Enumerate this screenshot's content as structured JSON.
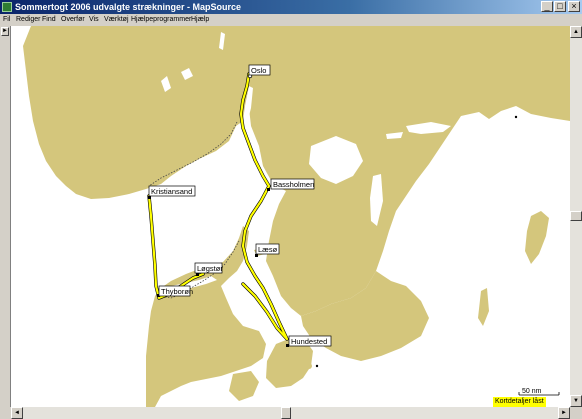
{
  "window": {
    "title": "Sommertogt 2006 udvalgte strækninger - MapSource",
    "min_glyph": "_",
    "max_glyph": "□",
    "close_glyph": "×"
  },
  "menu": {
    "items": [
      "Fil",
      "Rediger",
      "Find",
      "Overfør",
      "Vis",
      "Værktøj",
      "Hjælpeprogrammer",
      "Hjælp"
    ]
  },
  "map": {
    "land_color": "#d4c67c",
    "water_color": "#ffffff",
    "route_color": "#ffff00",
    "places": {
      "oslo": "Oslo",
      "bassholmen": "Bassholmen",
      "kristiansand": "Kristiansand",
      "laeso": "Læsø",
      "logstor": "Løgstør",
      "thyboron": "Thyborøn",
      "hundested": "Hundested"
    },
    "scale_label": "50 nm",
    "status": "Kortdetaljer låst"
  },
  "icons": {
    "app": "mapsource-icon",
    "left_arrow": "►",
    "up_arrow": "▲",
    "down_arrow": "▼",
    "scroll_left": "◄",
    "scroll_right": "►"
  }
}
